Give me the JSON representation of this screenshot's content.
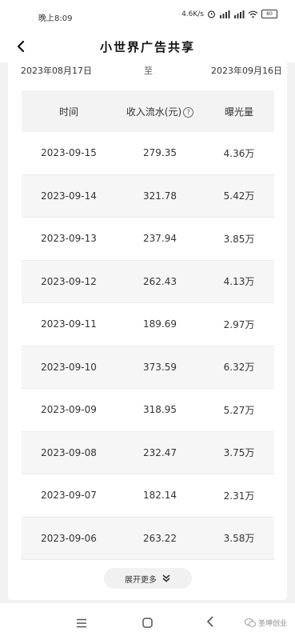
{
  "status_bar": {
    "time": "晚上8:09",
    "network_speed": "4.6K/s",
    "battery": "80"
  },
  "header": {
    "title": "小世界广告共享"
  },
  "date_range": {
    "start": "2023年08月17日",
    "separator": "至",
    "end": "2023年09月16日"
  },
  "table": {
    "headers": {
      "date": "时间",
      "income": "收入流水(元)",
      "exposure": "曝光量"
    },
    "rows": [
      {
        "date": "2023-09-15",
        "income": "279.35",
        "exposure": "4.36万"
      },
      {
        "date": "2023-09-14",
        "income": "321.78",
        "exposure": "5.42万"
      },
      {
        "date": "2023-09-13",
        "income": "237.94",
        "exposure": "3.85万"
      },
      {
        "date": "2023-09-12",
        "income": "262.43",
        "exposure": "4.13万"
      },
      {
        "date": "2023-09-11",
        "income": "189.69",
        "exposure": "2.97万"
      },
      {
        "date": "2023-09-10",
        "income": "373.59",
        "exposure": "6.32万"
      },
      {
        "date": "2023-09-09",
        "income": "318.95",
        "exposure": "5.27万"
      },
      {
        "date": "2023-09-08",
        "income": "232.47",
        "exposure": "3.75万"
      },
      {
        "date": "2023-09-07",
        "income": "182.14",
        "exposure": "2.31万"
      },
      {
        "date": "2023-09-06",
        "income": "263.22",
        "exposure": "3.58万"
      }
    ]
  },
  "more_button": {
    "label": "展开更多"
  },
  "watermark": {
    "text": "圣坤创业"
  }
}
